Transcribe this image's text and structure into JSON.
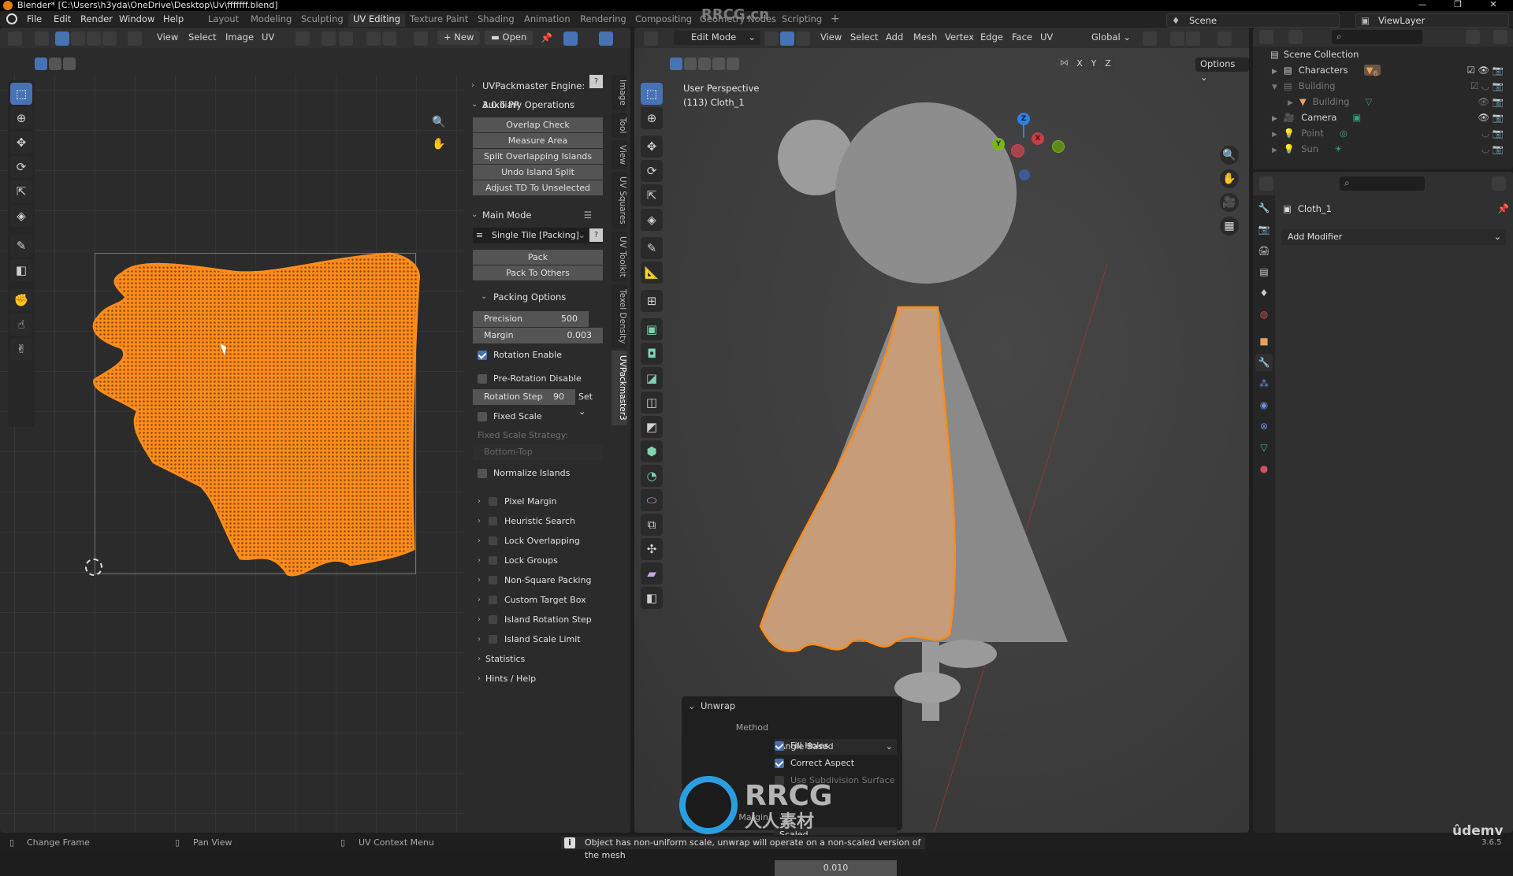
{
  "window": {
    "title": "Blender* [C:\\Users\\h3yda\\OneDrive\\Desktop\\Uv\\fffffff.blend]",
    "controls": [
      "minimize",
      "maximize",
      "close"
    ]
  },
  "menu": [
    "File",
    "Edit",
    "Render",
    "Window",
    "Help"
  ],
  "workspaces": [
    {
      "label": "Layout",
      "active": false
    },
    {
      "label": "Modeling",
      "active": false
    },
    {
      "label": "Sculpting",
      "active": false
    },
    {
      "label": "UV Editing",
      "active": true
    },
    {
      "label": "Texture Paint",
      "active": false
    },
    {
      "label": "Shading",
      "active": false
    },
    {
      "label": "Animation",
      "active": false
    },
    {
      "label": "Rendering",
      "active": false
    },
    {
      "label": "Compositing",
      "active": false
    },
    {
      "label": "Geometry Nodes",
      "active": false
    },
    {
      "label": "Scripting",
      "active": false
    }
  ],
  "add_workspace": "+",
  "scene": {
    "label": "Scene"
  },
  "view_layer": {
    "label": "ViewLayer"
  },
  "watermark": {
    "top": "RRCG.cn",
    "logo_text": "RRCG",
    "logo_sub": "人人素材",
    "udemy": "ûdemy",
    "version": "3.6.5"
  },
  "uv_editor": {
    "menus": [
      "View",
      "Select",
      "Image",
      "UV"
    ],
    "new_label": "New",
    "open_label": "Open",
    "tools": [
      "select-box",
      "cursor",
      "move",
      "rotate",
      "scale",
      "transform",
      "annotate",
      "rip-region",
      "grab",
      "relax",
      "pinch"
    ],
    "accent": "#ff8c1a"
  },
  "npanel": {
    "engine_header": "UVPackmaster Engine: 3.0.6 PR",
    "aux_header": "Auxiliary Operations",
    "aux_buttons": [
      "Overlap Check",
      "Measure Area",
      "Split Overlapping Islands",
      "Undo Island Split",
      "Adjust TD To Unselected"
    ],
    "main_mode_header": "Main Mode",
    "mode_select": "Single Tile [Packing]",
    "pack": "Pack",
    "pack_to_others": "Pack To Others",
    "packing_options_header": "Packing Options",
    "precision_label": "Precision",
    "precision_value": "500",
    "margin_label": "Margin",
    "margin_value": "0.003",
    "rotation_enable": {
      "label": "Rotation Enable",
      "checked": true
    },
    "pre_rotation_disable": {
      "label": "Pre-Rotation Disable",
      "checked": false
    },
    "rotation_step_label": "Rotation Step",
    "rotation_step_value": "90",
    "set_label": "Set",
    "fixed_scale": {
      "label": "Fixed Scale",
      "checked": false
    },
    "fixed_scale_strategy_label": "Fixed Scale Strategy:",
    "fixed_scale_strategy_value": "Bottom-Top",
    "normalize_islands": {
      "label": "Normalize Islands",
      "checked": false
    },
    "subpanels": [
      "Pixel Margin",
      "Heuristic Search",
      "Lock Overlapping",
      "Lock Groups",
      "Non-Square Packing",
      "Custom Target Box",
      "Island Rotation Step",
      "Island Scale Limit"
    ],
    "statistics": "Statistics",
    "hints": "Hints / Help"
  },
  "vertical_tabs": [
    {
      "label": "Image",
      "active": false
    },
    {
      "label": "Tool",
      "active": false
    },
    {
      "label": "View",
      "active": false
    },
    {
      "label": "UV Squares",
      "active": false
    },
    {
      "label": "UV Toolkit",
      "active": false
    },
    {
      "label": "Texel Density",
      "active": false
    },
    {
      "label": "UVPackmaster3",
      "active": true
    }
  ],
  "viewport": {
    "mode": "Edit Mode",
    "menus": [
      "View",
      "Select",
      "Add",
      "Mesh",
      "Vertex",
      "Edge",
      "Face",
      "UV"
    ],
    "transform_orientation": "Global",
    "options_label": "Options",
    "axes": [
      "X",
      "Y",
      "Z"
    ],
    "perspective": "User Perspective",
    "object_info": "(113) Cloth_1",
    "gizmo": {
      "x": "X",
      "y": "Y",
      "z": "Z",
      "x_color": "#e0414f",
      "y_color": "#7ab51d",
      "z_color": "#2f7fe0"
    }
  },
  "redo_panel": {
    "header": "Unwrap",
    "method_label": "Method",
    "method_value": "Angle Based",
    "fill_holes": {
      "label": "Fill Holes",
      "checked": true
    },
    "correct_aspect": {
      "label": "Correct Aspect",
      "checked": true
    },
    "use_subdivision": {
      "label": "Use Subdivision Surface",
      "checked": false
    },
    "margin_method_value": "Scaled",
    "margin_label": "Margin",
    "margin_value": "0.010"
  },
  "outliner": {
    "root": "Scene Collection",
    "items": [
      {
        "name": "Characters",
        "type": "collection",
        "visible": true,
        "badge": "6"
      },
      {
        "name": "Building",
        "type": "collection",
        "visible": false
      },
      {
        "name": "Building",
        "type": "mesh",
        "visible": true
      },
      {
        "name": "Camera",
        "type": "camera",
        "visible": true
      },
      {
        "name": "Point",
        "type": "light",
        "visible": false
      },
      {
        "name": "Sun",
        "type": "light",
        "visible": false
      }
    ]
  },
  "properties": {
    "object_name": "Cloth_1",
    "add_modifier": "Add Modifier",
    "tabs": [
      "tool",
      "render",
      "output",
      "view-layer",
      "scene",
      "world",
      "object",
      "modifiers",
      "particles",
      "physics",
      "constraints",
      "data",
      "material"
    ]
  },
  "status": {
    "left": "Change Frame",
    "middle": "Pan View",
    "right": "UV Context Menu",
    "message": "Object has non-uniform scale, unwrap will operate on a non-scaled version of the mesh"
  }
}
